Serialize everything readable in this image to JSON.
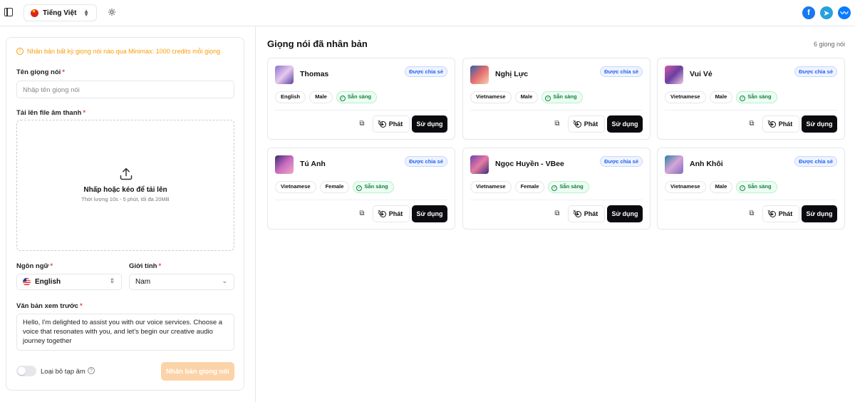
{
  "header": {
    "language": "Tiếng Việt"
  },
  "clone_form": {
    "notice": "Nhân bản bất kỳ giọng nói nào qua Minimax: 1000 credits mỗi giọng",
    "name_label": "Tên giọng nói",
    "name_placeholder": "Nhập tên giọng nói",
    "upload_label": "Tải lên file âm thanh",
    "upload_title": "Nhấp hoặc kéo để tải lên",
    "upload_hint": "Thời lượng 10s - 5 phút, tối đa 20MB",
    "language_label": "Ngôn ngữ",
    "language_value": "English",
    "gender_label": "Giới tính",
    "gender_value": "Nam",
    "preview_label": "Văn bản xem trước",
    "preview_text": "Hello, I'm delighted to assist you with our voice services. Choose a voice that resonates with you, and let's begin our creative audio journey together",
    "noise_label": "Loại bỏ tạp âm",
    "submit_label": "Nhân bản giọng nói",
    "required_mark": "*"
  },
  "cloned": {
    "title": "Giọng nói đã nhân bản",
    "count": "6 giọng nói",
    "share_label": "Được chia sẻ",
    "ready_label": "Sẵn sàng",
    "play_label": "Phát",
    "use_label": "Sử dụng",
    "voices": [
      {
        "name": "Thomas",
        "language": "English",
        "gender": "Male",
        "avatar_colors": [
          "#8a72c9",
          "#e6c9f0",
          "#5b3f9c"
        ]
      },
      {
        "name": "Nghị Lực",
        "language": "Vietnamese",
        "gender": "Male",
        "avatar_colors": [
          "#2f5fa8",
          "#e66e6e",
          "#f4d3b0"
        ]
      },
      {
        "name": "Vui Vẻ",
        "language": "Vietnamese",
        "gender": "Male",
        "avatar_colors": [
          "#d45aa8",
          "#6a3fa0",
          "#f2c9e6"
        ]
      },
      {
        "name": "Tú Anh",
        "language": "Vietnamese",
        "gender": "Female",
        "avatar_colors": [
          "#3a2a70",
          "#c86cc0",
          "#f1a9c8"
        ]
      },
      {
        "name": "Ngọc Huyền - VBee",
        "language": "Vietnamese",
        "gender": "Female",
        "avatar_colors": [
          "#6b3fb0",
          "#e67ca0",
          "#3c2c80"
        ]
      },
      {
        "name": "Anh Khôi",
        "language": "Vietnamese",
        "gender": "Male",
        "avatar_colors": [
          "#2c7fa6",
          "#d6a5d8",
          "#7f6cc0"
        ]
      }
    ]
  }
}
